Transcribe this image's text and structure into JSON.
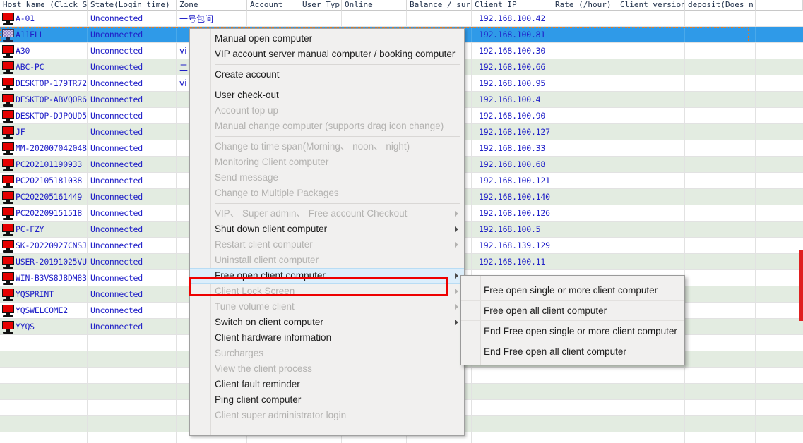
{
  "table": {
    "columns": [
      {
        "label": "Host Name (Click Sc"
      },
      {
        "label": "State(Login time)"
      },
      {
        "label": "Zone"
      },
      {
        "label": "Account"
      },
      {
        "label": "User Typ"
      },
      {
        "label": "Online"
      },
      {
        "label": "Balance / surpl"
      },
      {
        "label": "Client IP"
      },
      {
        "label": "Rate (/hour)"
      },
      {
        "label": "Client version"
      },
      {
        "label": "deposit(Does n"
      }
    ],
    "rows": [
      {
        "icon": "monitor-icon",
        "host": "A-01",
        "state": "Unconnected",
        "zone": "一号包间",
        "account": "",
        "user_type": "",
        "online": "",
        "balance": "",
        "ip": "192.168.100.42",
        "rate": "",
        "version": "",
        "deposit": "",
        "selected": false,
        "stripe": "white"
      },
      {
        "icon": "monitor-icon",
        "host": "A11ELL",
        "state": "Unconnected",
        "zone": "",
        "account": "",
        "user_type": "",
        "online": "",
        "balance": "",
        "ip": "192.168.100.81",
        "rate": "",
        "version": "",
        "deposit": "",
        "selected": true,
        "stripe": "sel"
      },
      {
        "icon": "monitor-icon",
        "host": "A30",
        "state": "Unconnected",
        "zone": "vi",
        "account": "",
        "user_type": "",
        "online": "",
        "balance": "",
        "ip": "192.168.100.30",
        "rate": "",
        "version": "",
        "deposit": "",
        "selected": false,
        "stripe": "white"
      },
      {
        "icon": "monitor-icon",
        "host": "ABC-PC",
        "state": "Unconnected",
        "zone": "二",
        "account": "",
        "user_type": "",
        "online": "",
        "balance": "",
        "ip": "192.168.100.66",
        "rate": "",
        "version": "",
        "deposit": "",
        "selected": false,
        "stripe": "alt"
      },
      {
        "icon": "monitor-icon",
        "host": "DESKTOP-179TR72",
        "state": "Unconnected",
        "zone": "vi",
        "account": "",
        "user_type": "",
        "online": "",
        "balance": "",
        "ip": "192.168.100.95",
        "rate": "",
        "version": "",
        "deposit": "",
        "selected": false,
        "stripe": "white"
      },
      {
        "icon": "monitor-icon",
        "host": "DESKTOP-ABVQOR6",
        "state": "Unconnected",
        "zone": "",
        "account": "",
        "user_type": "",
        "online": "",
        "balance": "",
        "ip": "192.168.100.4",
        "rate": "",
        "version": "",
        "deposit": "",
        "selected": false,
        "stripe": "alt"
      },
      {
        "icon": "monitor-icon",
        "host": "DESKTOP-DJPQUD5",
        "state": "Unconnected",
        "zone": "",
        "account": "",
        "user_type": "",
        "online": "",
        "balance": "",
        "ip": "192.168.100.90",
        "rate": "",
        "version": "",
        "deposit": "",
        "selected": false,
        "stripe": "white"
      },
      {
        "icon": "monitor-icon",
        "host": "JF",
        "state": "Unconnected",
        "zone": "",
        "account": "",
        "user_type": "",
        "online": "",
        "balance": "",
        "ip": "192.168.100.127",
        "rate": "",
        "version": "",
        "deposit": "",
        "selected": false,
        "stripe": "alt"
      },
      {
        "icon": "monitor-icon",
        "host": "MM-202007042048",
        "state": "Unconnected",
        "zone": "",
        "account": "",
        "user_type": "",
        "online": "",
        "balance": "",
        "ip": "192.168.100.33",
        "rate": "",
        "version": "",
        "deposit": "",
        "selected": false,
        "stripe": "white"
      },
      {
        "icon": "monitor-icon",
        "host": "PC202101190933",
        "state": "Unconnected",
        "zone": "",
        "account": "",
        "user_type": "",
        "online": "",
        "balance": "",
        "ip": "192.168.100.68",
        "rate": "",
        "version": "",
        "deposit": "",
        "selected": false,
        "stripe": "alt"
      },
      {
        "icon": "monitor-icon",
        "host": "PC202105181038",
        "state": "Unconnected",
        "zone": "",
        "account": "",
        "user_type": "",
        "online": "",
        "balance": "",
        "ip": "192.168.100.121",
        "rate": "",
        "version": "",
        "deposit": "",
        "selected": false,
        "stripe": "white"
      },
      {
        "icon": "monitor-icon",
        "host": "PC202205161449",
        "state": "Unconnected",
        "zone": "",
        "account": "",
        "user_type": "",
        "online": "",
        "balance": "",
        "ip": "192.168.100.140",
        "rate": "",
        "version": "",
        "deposit": "",
        "selected": false,
        "stripe": "alt"
      },
      {
        "icon": "monitor-icon",
        "host": "PC202209151518",
        "state": "Unconnected",
        "zone": "",
        "account": "",
        "user_type": "",
        "online": "",
        "balance": "",
        "ip": "192.168.100.126",
        "rate": "",
        "version": "",
        "deposit": "",
        "selected": false,
        "stripe": "white"
      },
      {
        "icon": "monitor-icon",
        "host": "PC-FZY",
        "state": "Unconnected",
        "zone": "",
        "account": "",
        "user_type": "",
        "online": "",
        "balance": "",
        "ip": "192.168.100.5",
        "rate": "",
        "version": "",
        "deposit": "",
        "selected": false,
        "stripe": "alt"
      },
      {
        "icon": "monitor-icon",
        "host": "SK-20220927CNSJ",
        "state": "Unconnected",
        "zone": "",
        "account": "",
        "user_type": "",
        "online": "",
        "balance": "",
        "ip": "192.168.139.129",
        "rate": "",
        "version": "",
        "deposit": "",
        "selected": false,
        "stripe": "white"
      },
      {
        "icon": "monitor-icon",
        "host": "USER-20191025VU",
        "state": "Unconnected",
        "zone": "",
        "account": "",
        "user_type": "",
        "online": "",
        "balance": "",
        "ip": "192.168.100.11",
        "rate": "",
        "version": "",
        "deposit": "",
        "selected": false,
        "stripe": "alt"
      },
      {
        "icon": "monitor-icon",
        "host": "WIN-B3VS8J8DM83",
        "state": "Unconnected",
        "zone": "",
        "account": "",
        "user_type": "",
        "online": "",
        "balance": "",
        "ip": "",
        "rate": "",
        "version": "",
        "deposit": "",
        "selected": false,
        "stripe": "white"
      },
      {
        "icon": "monitor-icon",
        "host": "YQSPRINT",
        "state": "Unconnected",
        "zone": "",
        "account": "",
        "user_type": "",
        "online": "",
        "balance": "",
        "ip": "",
        "rate": "",
        "version": "",
        "deposit": "",
        "selected": false,
        "stripe": "alt"
      },
      {
        "icon": "monitor-icon",
        "host": "YQSWELCOME2",
        "state": "Unconnected",
        "zone": "",
        "account": "",
        "user_type": "",
        "online": "",
        "balance": "",
        "ip": "",
        "rate": "",
        "version": "",
        "deposit": "",
        "selected": false,
        "stripe": "white"
      },
      {
        "icon": "monitor-icon",
        "host": "YYQS",
        "state": "Unconnected",
        "zone": "",
        "account": "",
        "user_type": "",
        "online": "",
        "balance": "",
        "ip": "",
        "rate": "",
        "version": "",
        "deposit": "",
        "selected": false,
        "stripe": "alt"
      },
      {
        "icon": "",
        "host": "",
        "state": "",
        "zone": "",
        "account": "",
        "user_type": "",
        "online": "",
        "balance": "",
        "ip": "",
        "rate": "",
        "version": "",
        "deposit": "",
        "selected": false,
        "stripe": "white"
      },
      {
        "icon": "",
        "host": "",
        "state": "",
        "zone": "",
        "account": "",
        "user_type": "",
        "online": "",
        "balance": "",
        "ip": "",
        "rate": "",
        "version": "",
        "deposit": "",
        "selected": false,
        "stripe": "alt"
      },
      {
        "icon": "",
        "host": "",
        "state": "",
        "zone": "",
        "account": "",
        "user_type": "",
        "online": "",
        "balance": "",
        "ip": "",
        "rate": "",
        "version": "",
        "deposit": "",
        "selected": false,
        "stripe": "white"
      },
      {
        "icon": "",
        "host": "",
        "state": "",
        "zone": "",
        "account": "",
        "user_type": "",
        "online": "",
        "balance": "",
        "ip": "",
        "rate": "",
        "version": "",
        "deposit": "",
        "selected": false,
        "stripe": "alt"
      },
      {
        "icon": "",
        "host": "",
        "state": "",
        "zone": "",
        "account": "",
        "user_type": "",
        "online": "",
        "balance": "",
        "ip": "",
        "rate": "",
        "version": "",
        "deposit": "",
        "selected": false,
        "stripe": "white"
      },
      {
        "icon": "",
        "host": "",
        "state": "",
        "zone": "",
        "account": "",
        "user_type": "",
        "online": "",
        "balance": "",
        "ip": "",
        "rate": "",
        "version": "",
        "deposit": "",
        "selected": false,
        "stripe": "alt"
      },
      {
        "icon": "",
        "host": "",
        "state": "",
        "zone": "",
        "account": "",
        "user_type": "",
        "online": "",
        "balance": "",
        "ip": "",
        "rate": "",
        "version": "",
        "deposit": "",
        "selected": false,
        "stripe": "white"
      }
    ]
  },
  "context_menu": {
    "items": [
      {
        "label": "Manual open computer",
        "disabled": false,
        "submenu": false,
        "separator_after": false,
        "hovered": false
      },
      {
        "label": "VIP account server manual computer / booking computer",
        "disabled": false,
        "submenu": false,
        "separator_after": true,
        "hovered": false
      },
      {
        "label": "Create account",
        "disabled": false,
        "submenu": false,
        "separator_after": true,
        "hovered": false
      },
      {
        "label": "User check-out",
        "disabled": false,
        "submenu": false,
        "separator_after": false,
        "hovered": false
      },
      {
        "label": "Account top up",
        "disabled": true,
        "submenu": false,
        "separator_after": false,
        "hovered": false
      },
      {
        "label": "Manual change computer (supports drag icon change)",
        "disabled": true,
        "submenu": false,
        "separator_after": true,
        "hovered": false
      },
      {
        "label": "Change to time span(Morning、 noon、 night)",
        "disabled": true,
        "submenu": false,
        "separator_after": false,
        "hovered": false
      },
      {
        "label": "Monitoring Client computer",
        "disabled": true,
        "submenu": false,
        "separator_after": false,
        "hovered": false
      },
      {
        "label": "Send message",
        "disabled": true,
        "submenu": false,
        "separator_after": false,
        "hovered": false
      },
      {
        "label": "Change to Multiple Packages",
        "disabled": true,
        "submenu": false,
        "separator_after": true,
        "hovered": false
      },
      {
        "label": "VIP、 Super admin、 Free account Checkout",
        "disabled": true,
        "submenu": true,
        "separator_after": false,
        "hovered": false
      },
      {
        "label": "Shut down client computer",
        "disabled": false,
        "submenu": true,
        "separator_after": false,
        "hovered": false
      },
      {
        "label": "Restart client computer",
        "disabled": true,
        "submenu": true,
        "separator_after": false,
        "hovered": false
      },
      {
        "label": "Uninstall client computer",
        "disabled": true,
        "submenu": false,
        "separator_after": false,
        "hovered": false
      },
      {
        "label": "Free open client computer",
        "disabled": false,
        "submenu": true,
        "separator_after": false,
        "hovered": true
      },
      {
        "label": "Client Lock Screen",
        "disabled": true,
        "submenu": true,
        "separator_after": false,
        "hovered": false
      },
      {
        "label": "Tune  volume client",
        "disabled": true,
        "submenu": true,
        "separator_after": false,
        "hovered": false
      },
      {
        "label": "Switch on client computer",
        "disabled": false,
        "submenu": true,
        "separator_after": false,
        "hovered": false
      },
      {
        "label": "Client hardware information",
        "disabled": false,
        "submenu": false,
        "separator_after": false,
        "hovered": false
      },
      {
        "label": "Surcharges",
        "disabled": true,
        "submenu": false,
        "separator_after": false,
        "hovered": false
      },
      {
        "label": "View the client process",
        "disabled": true,
        "submenu": false,
        "separator_after": false,
        "hovered": false
      },
      {
        "label": "Client fault reminder",
        "disabled": false,
        "submenu": false,
        "separator_after": false,
        "hovered": false
      },
      {
        "label": "Ping client computer",
        "disabled": false,
        "submenu": false,
        "separator_after": false,
        "hovered": false
      },
      {
        "label": "Client super administrator login",
        "disabled": true,
        "submenu": false,
        "separator_after": false,
        "hovered": false
      }
    ]
  },
  "submenu": {
    "items": [
      {
        "label": "Free open single or more client computer"
      },
      {
        "label": "Free open all client computer"
      },
      {
        "label": "End Free open single or more client computer"
      },
      {
        "label": "End Free open all client computer"
      }
    ]
  },
  "colors": {
    "selection_blue": "#2f9ae8",
    "row_stripe_green": "#e3ece1",
    "text_blue": "#2020c8",
    "annotation_red": "#ee0000",
    "menu_hover_blue": "#dceefb",
    "monitor_red": "#e50000"
  }
}
